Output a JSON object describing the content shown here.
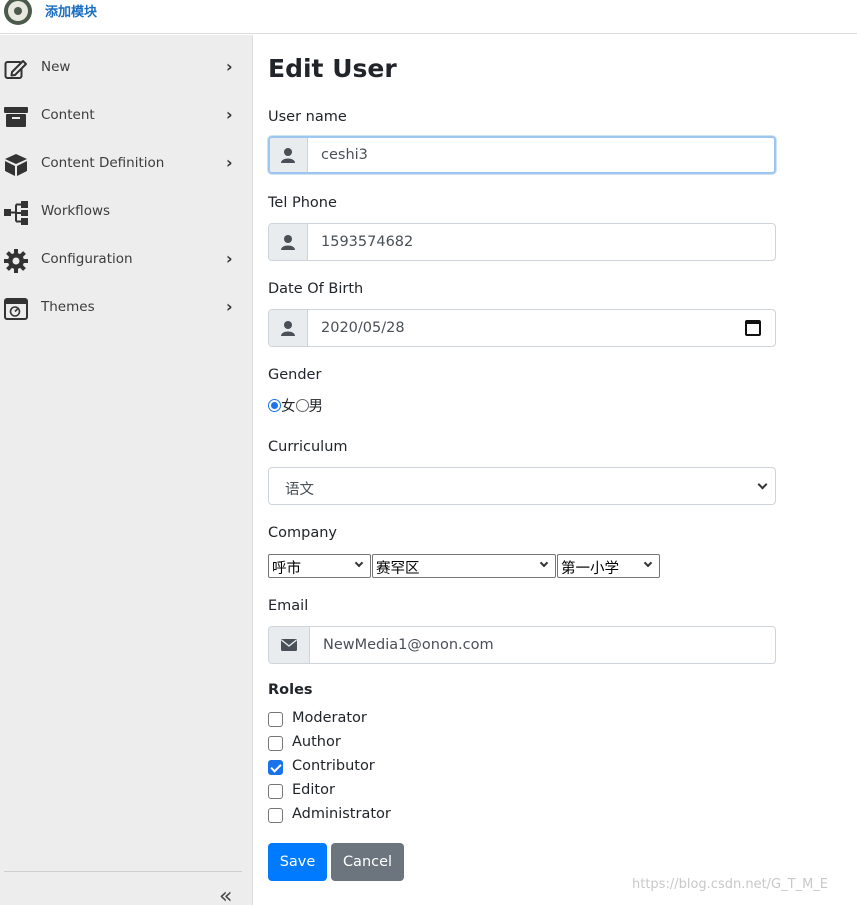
{
  "header": {
    "brand": "添加模块"
  },
  "sidebar": {
    "items": [
      {
        "label": "New",
        "icon": "edit-icon"
      },
      {
        "label": "Content",
        "icon": "archive-icon"
      },
      {
        "label": "Content Definition",
        "icon": "cube-icon"
      },
      {
        "label": "Workflows",
        "icon": "sitemap-icon"
      },
      {
        "label": "Configuration",
        "icon": "gear-icon"
      },
      {
        "label": "Themes",
        "icon": "theme-icon"
      }
    ],
    "collapse_glyph": "«"
  },
  "form": {
    "title": "Edit User",
    "username": {
      "label": "User name",
      "value": "ceshi3"
    },
    "phone": {
      "label": "Tel Phone",
      "value": "1593574682"
    },
    "dob": {
      "label": "Date Of Birth",
      "value": "2020/05/28"
    },
    "gender": {
      "label": "Gender",
      "options": [
        "女",
        "男"
      ],
      "selected": "女"
    },
    "curriculum": {
      "label": "Curriculum",
      "value": "语文"
    },
    "company": {
      "label": "Company",
      "city": "呼市",
      "district": "赛罕区",
      "school": "第一小学"
    },
    "email": {
      "label": "Email",
      "value": "NewMedia1@onon.com"
    },
    "roles": {
      "title": "Roles",
      "items": [
        {
          "label": "Moderator",
          "checked": false
        },
        {
          "label": "Author",
          "checked": false
        },
        {
          "label": "Contributor",
          "checked": true
        },
        {
          "label": "Editor",
          "checked": false
        },
        {
          "label": "Administrator",
          "checked": false
        }
      ]
    },
    "save_label": "Save",
    "cancel_label": "Cancel"
  },
  "watermark": "https://blog.csdn.net/G_T_M_E",
  "colors": {
    "primary": "#007bff",
    "secondary": "#6c757d",
    "brand": "#1b6ec2",
    "sidebar_bg": "#ededed"
  }
}
